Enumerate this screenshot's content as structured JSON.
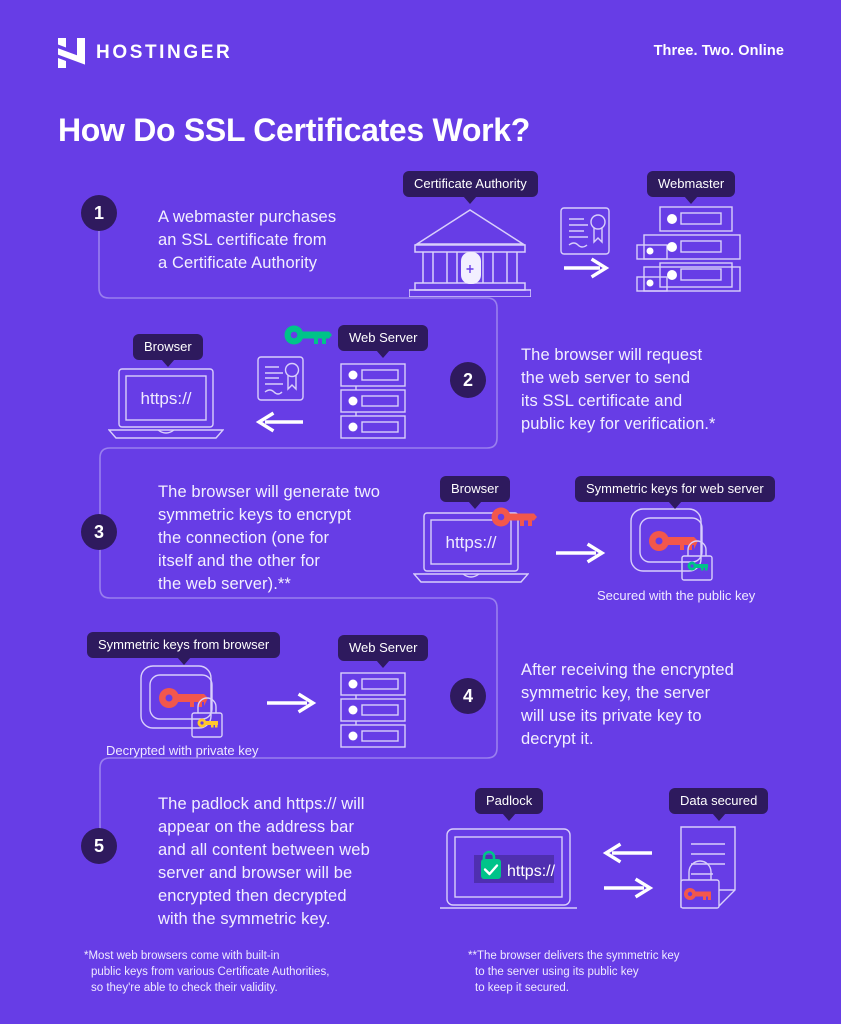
{
  "brand": {
    "logo_text": "HOSTINGER",
    "logo_icon": "hostinger-h-logo",
    "tagline": "Three. Two. Online"
  },
  "page_title": "How Do SSL Certificates Work?",
  "colors": {
    "background": "#673de6",
    "badge": "#2e1a5e",
    "step_circle": "#2f1a5e",
    "key_green": "#00c389",
    "key_red": "#f2574c",
    "key_yellow": "#ffc72c",
    "lock_green": "#00c389",
    "line": "#b9a8f5",
    "text": "#ffffff"
  },
  "steps": [
    {
      "number": "1",
      "text_lines": [
        "A webmaster purchases",
        "an SSL certificate from",
        "a Certificate Authority"
      ],
      "badges": [
        "Certificate Authority",
        "Webmaster"
      ],
      "icons": [
        "bank-icon",
        "certificate-icon",
        "arrow-right-icon",
        "server-stack-icon"
      ],
      "caption": ""
    },
    {
      "number": "2",
      "text_lines": [
        "The browser will request",
        "the web server to send",
        "its SSL certificate and",
        "public key for verification.*"
      ],
      "badges": [
        "Browser",
        "Web Server"
      ],
      "icons": [
        "laptop-https-icon",
        "green-key-icon",
        "certificate-icon",
        "arrow-left-icon",
        "server-rack-icon"
      ],
      "caption": ""
    },
    {
      "number": "3",
      "text_lines": [
        "The browser will generate two",
        "symmetric keys to encrypt",
        "the connection (one for",
        "itself and the other for",
        "the web server).**"
      ],
      "badges": [
        "Browser",
        "Symmetric keys for web server"
      ],
      "icons": [
        "laptop-https-key-icon",
        "arrow-right-icon",
        "encrypted-key-lock-icon"
      ],
      "caption": "Secured with the public key"
    },
    {
      "number": "4",
      "text_lines": [
        "After receiving the encrypted",
        "symmetric key, the server",
        "will use its private key to",
        "decrypt it."
      ],
      "badges": [
        "Symmetric keys from browser",
        "Web Server"
      ],
      "icons": [
        "encrypted-key-lock-icon",
        "arrow-right-icon",
        "server-rack-icon"
      ],
      "caption": "Decrypted with private key"
    },
    {
      "number": "5",
      "text_lines": [
        "The padlock and https:// will",
        "appear on the address bar",
        "and all content between web",
        "server and browser will be",
        "encrypted then decrypted",
        "with the symmetric key."
      ],
      "badges": [
        "Padlock",
        "Data secured"
      ],
      "icons": [
        "laptop-address-bar-icon",
        "arrow-left-icon",
        "arrow-right-icon",
        "secured-document-icon"
      ],
      "caption": ""
    }
  ],
  "browser_url_text": "https://",
  "footnotes": [
    {
      "marker": "*",
      "lines": [
        "*Most web browsers come with built-in",
        "public keys from various Certificate Authorities,",
        "so they're able to check their validity."
      ]
    },
    {
      "marker": "**",
      "lines": [
        "**The browser delivers the symmetric key",
        "to the server using its public key",
        "to keep it secured."
      ]
    }
  ]
}
